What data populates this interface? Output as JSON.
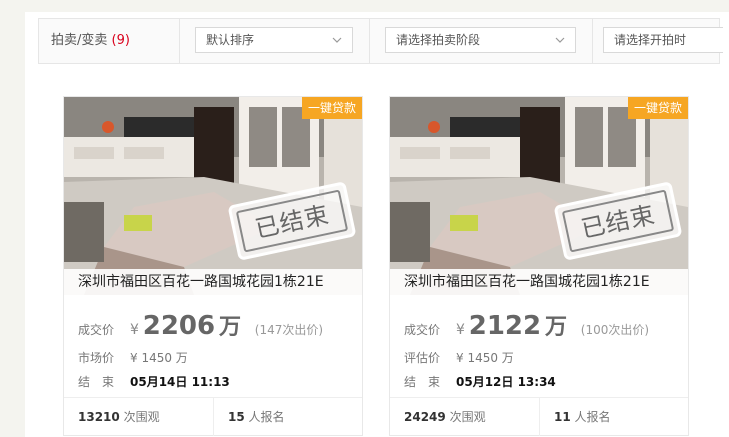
{
  "filter": {
    "label": "拍卖/变卖",
    "count": "9",
    "sort_value": "默认排序",
    "stage_placeholder": "请选择拍卖阶段",
    "time_placeholder": "请选择开拍时"
  },
  "colors": {
    "accent_orange": "#f6a623",
    "count_red": "#d9001b"
  },
  "cards": [
    {
      "tag": "一键贷款",
      "stamp": "已结束",
      "title": "深圳市福田区百花一路国城花园1栋21E",
      "deal_label": "成交价",
      "yen": "¥",
      "price": "2206",
      "price_unit": "万",
      "bids": "(147次出价)",
      "ref_label": "市场价",
      "ref_value": "¥ 1450 万",
      "end_label": "结　束",
      "end_time": "05月14日 11:13",
      "views_num": "13210",
      "views_label": "次围观",
      "signups_num": "15",
      "signups_label": "人报名"
    },
    {
      "tag": "一键贷款",
      "stamp": "已结束",
      "title": "深圳市福田区百花一路国城花园1栋21E",
      "deal_label": "成交价",
      "yen": "¥",
      "price": "2122",
      "price_unit": "万",
      "bids": "(100次出价)",
      "ref_label": "评估价",
      "ref_value": "¥ 1450 万",
      "end_label": "结　束",
      "end_time": "05月12日 13:34",
      "views_num": "24249",
      "views_label": "次围观",
      "signups_num": "11",
      "signups_label": "人报名"
    }
  ]
}
